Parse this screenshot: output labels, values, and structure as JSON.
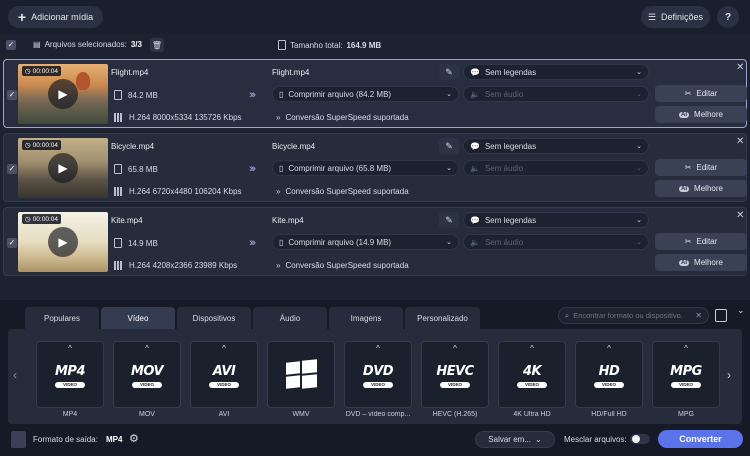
{
  "toolbar": {
    "add_media_label": "Adicionar mídia",
    "settings_label": "Definições",
    "help_label": "?"
  },
  "selection": {
    "files_label": "Arquivos selecionados:",
    "files_value": "3/3",
    "total_label": "Tamanho total:",
    "total_value": "164.9 MB"
  },
  "files": [
    {
      "duration": "00:00:04",
      "name": "Flight.mp4",
      "size": "84.2 MB",
      "meta": "H.264 8000x5334 135726 Kbps",
      "output_name": "Flight.mp4",
      "compress": "Comprimir arquivo (84.2 MB)",
      "subtitles": "Sem legendas",
      "audio": "Sem áudio",
      "superspeed": "Conversão SuperSpeed suportada",
      "edit_label": "Editar",
      "better_label": "Melhore",
      "ai_label": "AI"
    },
    {
      "duration": "00:00:04",
      "name": "Bicycle.mp4",
      "size": "65.8 MB",
      "meta": "H.264 6720x4480 106204 Kbps",
      "output_name": "Bicycle.mp4",
      "compress": "Comprimir arquivo (65.8 MB)",
      "subtitles": "Sem legendas",
      "audio": "Sem áudio",
      "superspeed": "Conversão SuperSpeed suportada",
      "edit_label": "Editar",
      "better_label": "Melhore",
      "ai_label": "AI"
    },
    {
      "duration": "00:00:04",
      "name": "Kite.mp4",
      "size": "14.9 MB",
      "meta": "H.264 4208x2366 23989 Kbps",
      "output_name": "Kite.mp4",
      "compress": "Comprimir arquivo (14.9 MB)",
      "subtitles": "Sem legendas",
      "audio": "Sem áudio",
      "superspeed": "Conversão SuperSpeed suportada",
      "edit_label": "Editar",
      "better_label": "Melhore",
      "ai_label": "AI"
    }
  ],
  "tabs": [
    "Populares",
    "Vídeo",
    "Dispositivos",
    "Áudio",
    "Imagens",
    "Personalizado"
  ],
  "active_tab": "Vídeo",
  "search": {
    "placeholder": "Encontrar formato ou dispositivo..."
  },
  "formats": [
    {
      "logo": "MP4",
      "sub": "VIDEO",
      "label": "MP4"
    },
    {
      "logo": "MOV",
      "sub": "VIDEO",
      "label": "MOV"
    },
    {
      "logo": "AVI",
      "sub": "VIDEO",
      "label": "AVI"
    },
    {
      "logo": "",
      "sub": "",
      "label": "WMV",
      "icon": "windows-logo-icon"
    },
    {
      "logo": "DVD",
      "sub": "VIDEO",
      "label": "DVD – vídeo comp..."
    },
    {
      "logo": "HEVC",
      "sub": "VIDEO",
      "label": "HEVC (H.265)"
    },
    {
      "logo": "4K",
      "sub": "VIDEO",
      "label": "4K Ultra HD"
    },
    {
      "logo": "HD",
      "sub": "VIDEO",
      "label": "HD/Full HD"
    },
    {
      "logo": "MPG",
      "sub": "VIDEO",
      "label": "MPG"
    }
  ],
  "footer": {
    "output_label": "Formato de saída:",
    "output_value": "MP4",
    "save_label": "Salvar em...",
    "merge_label": "Mesclar arquivos:",
    "merge_on": false,
    "convert_label": "Converter"
  },
  "colors": {
    "accent": "#5b73e8",
    "background": "#1d2231",
    "row_background": "#262c3c"
  }
}
